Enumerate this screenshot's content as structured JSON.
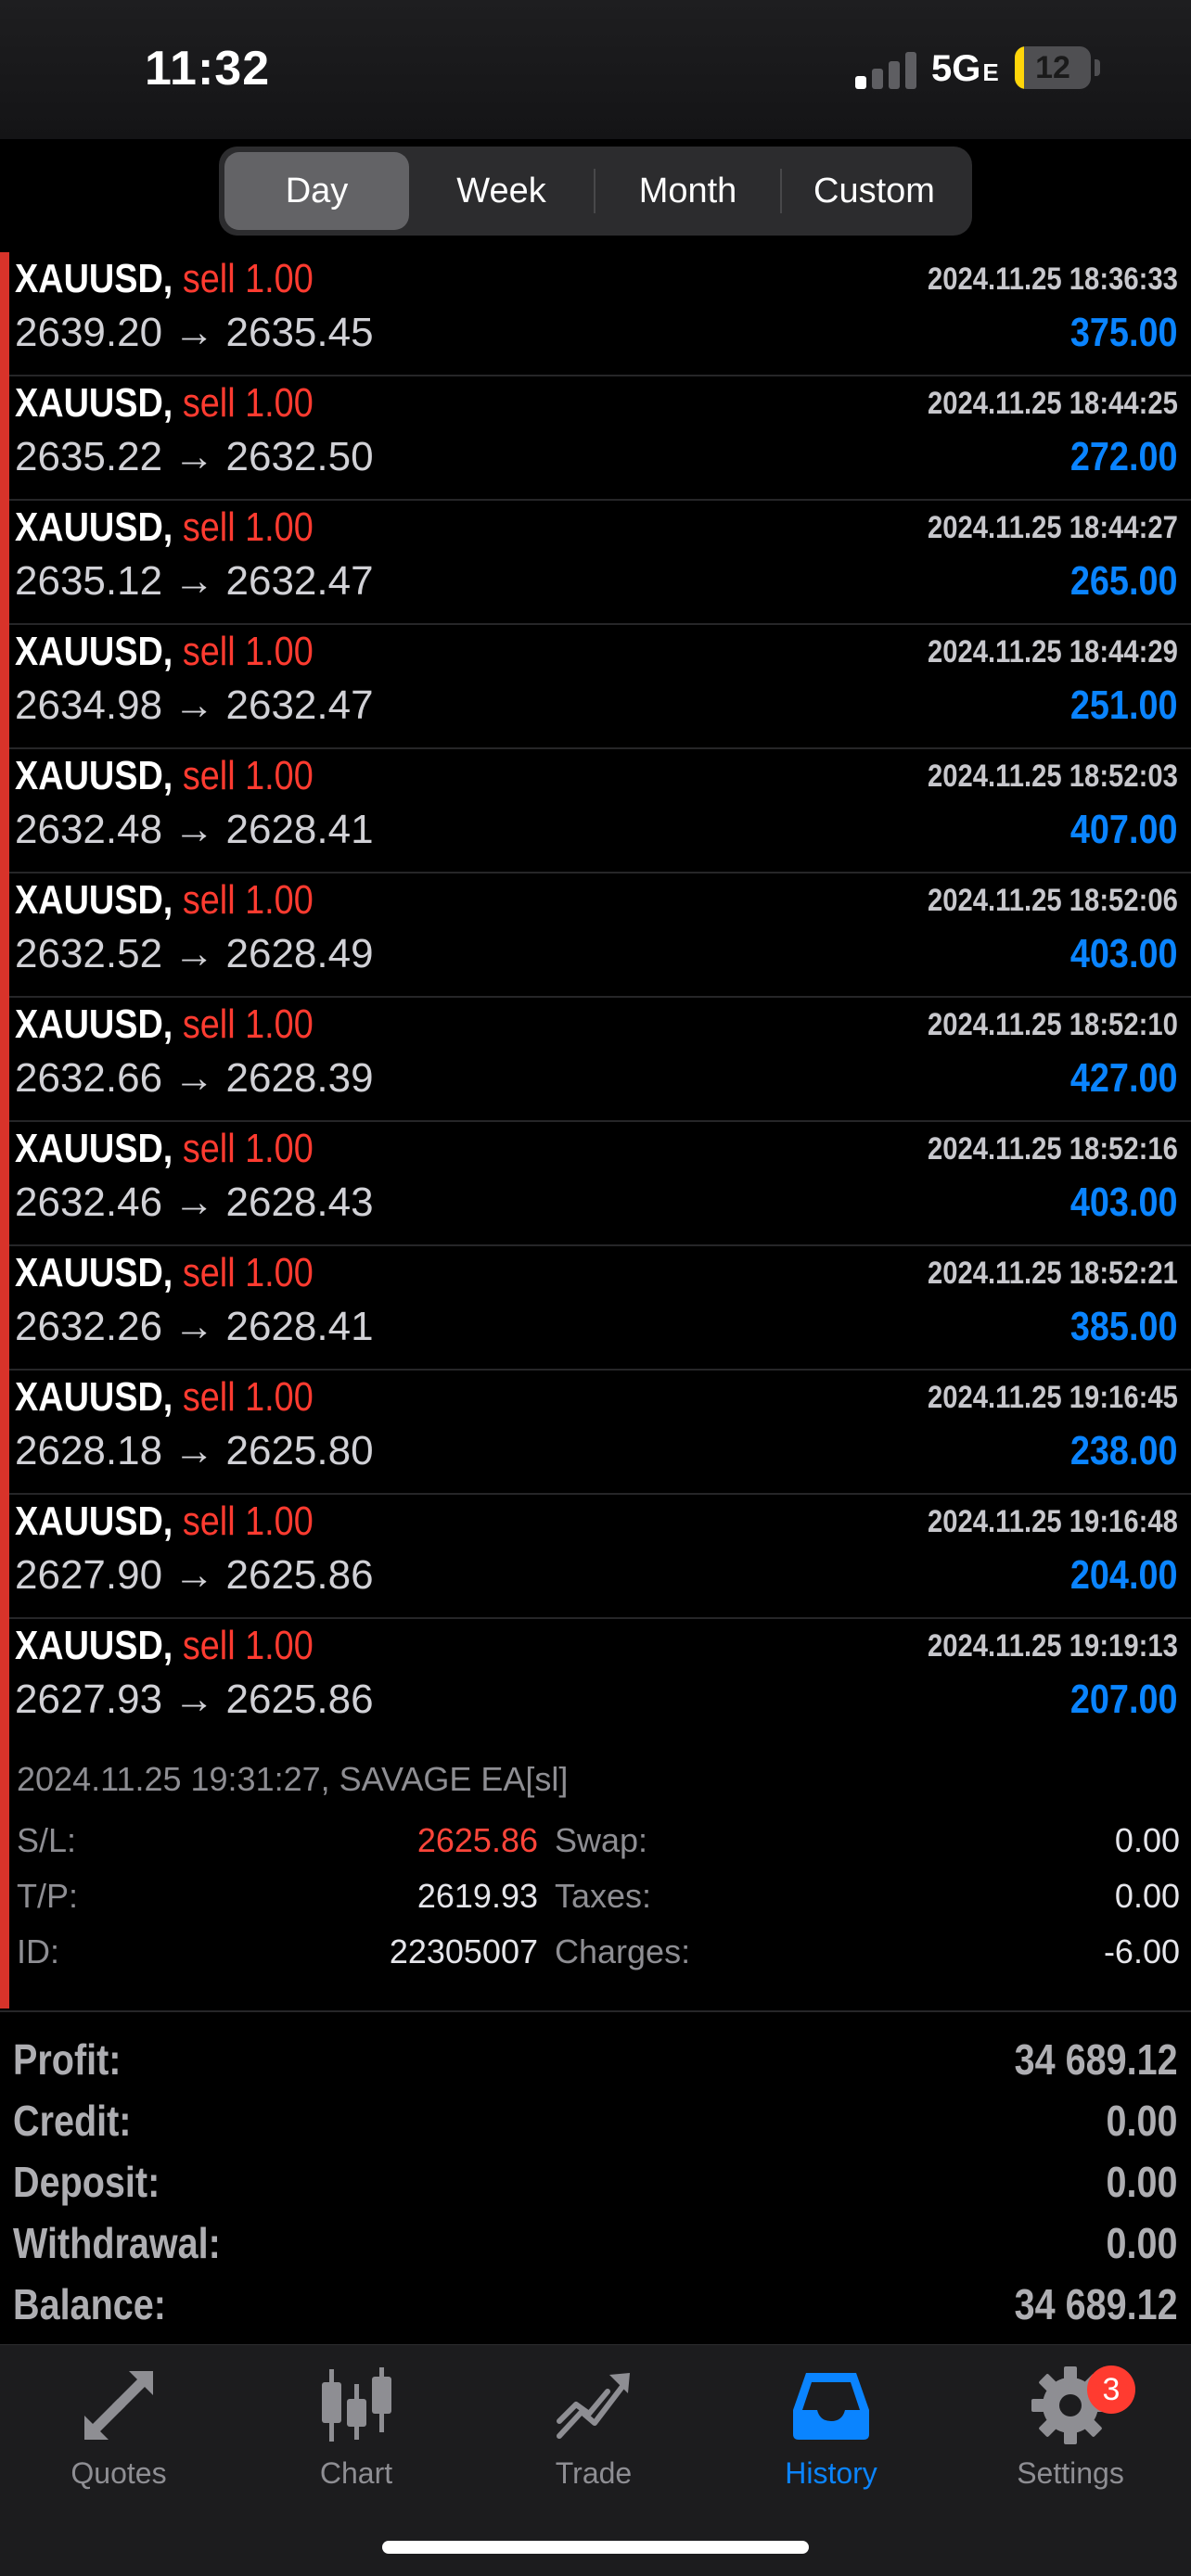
{
  "status_bar": {
    "time": "11:32",
    "network": "5G",
    "network_suffix": "E",
    "battery_level": "12",
    "battery_fraction": 0.12
  },
  "period_tabs": [
    "Day",
    "Week",
    "Month",
    "Custom"
  ],
  "active_period": "Day",
  "trades": [
    {
      "symbol": "XAUUSD,",
      "side": "sell 1.00",
      "time": "2024.11.25 18:36:33",
      "prices": "2639.20 → 2635.45",
      "profit": "375.00"
    },
    {
      "symbol": "XAUUSD,",
      "side": "sell 1.00",
      "time": "2024.11.25 18:44:25",
      "prices": "2635.22 → 2632.50",
      "profit": "272.00"
    },
    {
      "symbol": "XAUUSD,",
      "side": "sell 1.00",
      "time": "2024.11.25 18:44:27",
      "prices": "2635.12 → 2632.47",
      "profit": "265.00"
    },
    {
      "symbol": "XAUUSD,",
      "side": "sell 1.00",
      "time": "2024.11.25 18:44:29",
      "prices": "2634.98 → 2632.47",
      "profit": "251.00"
    },
    {
      "symbol": "XAUUSD,",
      "side": "sell 1.00",
      "time": "2024.11.25 18:52:03",
      "prices": "2632.48 → 2628.41",
      "profit": "407.00"
    },
    {
      "symbol": "XAUUSD,",
      "side": "sell 1.00",
      "time": "2024.11.25 18:52:06",
      "prices": "2632.52 → 2628.49",
      "profit": "403.00"
    },
    {
      "symbol": "XAUUSD,",
      "side": "sell 1.00",
      "time": "2024.11.25 18:52:10",
      "prices": "2632.66 → 2628.39",
      "profit": "427.00"
    },
    {
      "symbol": "XAUUSD,",
      "side": "sell 1.00",
      "time": "2024.11.25 18:52:16",
      "prices": "2632.46 → 2628.43",
      "profit": "403.00"
    },
    {
      "symbol": "XAUUSD,",
      "side": "sell 1.00",
      "time": "2024.11.25 18:52:21",
      "prices": "2632.26 → 2628.41",
      "profit": "385.00"
    },
    {
      "symbol": "XAUUSD,",
      "side": "sell 1.00",
      "time": "2024.11.25 19:16:45",
      "prices": "2628.18 → 2625.80",
      "profit": "238.00"
    },
    {
      "symbol": "XAUUSD,",
      "side": "sell 1.00",
      "time": "2024.11.25 19:16:48",
      "prices": "2627.90 → 2625.86",
      "profit": "204.00"
    },
    {
      "symbol": "XAUUSD,",
      "side": "sell 1.00",
      "time": "2024.11.25 19:19:13",
      "prices": "2627.93 → 2625.86",
      "profit": "207.00"
    }
  ],
  "selected_details": {
    "header": "2024.11.25 19:31:27, SAVAGE EA[sl]",
    "sl_label": "S/L:",
    "sl_value": "2625.86",
    "tp_label": "T/P:",
    "tp_value": "2619.93",
    "id_label": "ID:",
    "id_value": "22305007",
    "swap_label": "Swap:",
    "swap_value": "0.00",
    "taxes_label": "Taxes:",
    "taxes_value": "0.00",
    "charges_label": "Charges:",
    "charges_value": "-6.00"
  },
  "summary": {
    "profit_label": "Profit:",
    "profit": "34 689.12",
    "credit_label": "Credit:",
    "credit": "0.00",
    "deposit_label": "Deposit:",
    "deposit": "0.00",
    "withdrawal_label": "Withdrawal:",
    "withdrawal": "0.00",
    "balance_label": "Balance:",
    "balance": "34 689.12"
  },
  "tab_bar": {
    "quotes": "Quotes",
    "chart": "Chart",
    "trade": "Trade",
    "history": "History",
    "settings": "Settings",
    "settings_badge": "3",
    "active": "History"
  },
  "colors": {
    "sell": "#ff3b30",
    "profit": "#0a84ff",
    "accent": "#0a84ff",
    "sidebar_marker": "#d8332a"
  }
}
